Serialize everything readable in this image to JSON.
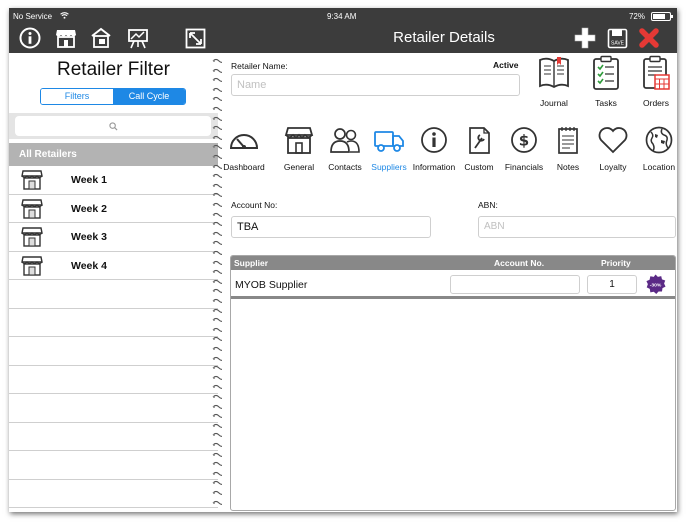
{
  "status_bar": {
    "carrier": "No Service",
    "time": "9:34 AM",
    "battery": "72%"
  },
  "header": {
    "title": "Retailer Details"
  },
  "left_panel": {
    "title": "Retailer Filter",
    "segments": [
      "Filters",
      "Call Cycle"
    ],
    "selected_segment": "Call Cycle",
    "search_placeholder": "",
    "section_header": "All Retailers",
    "items": [
      {
        "label": "Week 1"
      },
      {
        "label": "Week 2"
      },
      {
        "label": "Week 3"
      },
      {
        "label": "Week 4"
      }
    ]
  },
  "retailer": {
    "name_label": "Retailer Name:",
    "status": "Active",
    "name_placeholder": "Name",
    "name_value": ""
  },
  "actions": [
    {
      "label": "Journal",
      "icon": "journal-icon"
    },
    {
      "label": "Tasks",
      "icon": "tasks-icon"
    },
    {
      "label": "Orders",
      "icon": "orders-icon"
    }
  ],
  "tabs": [
    {
      "label": "Dashboard",
      "icon": "gauge-icon"
    },
    {
      "label": "General",
      "icon": "storefront-icon"
    },
    {
      "label": "Contacts",
      "icon": "people-icon"
    },
    {
      "label": "Suppliers",
      "icon": "truck-icon",
      "active": true
    },
    {
      "label": "Information",
      "icon": "info-icon"
    },
    {
      "label": "Custom",
      "icon": "wrench-document-icon"
    },
    {
      "label": "Financials",
      "icon": "dollar-icon"
    },
    {
      "label": "Notes",
      "icon": "notepad-icon"
    },
    {
      "label": "Loyalty",
      "icon": "heart-icon"
    },
    {
      "label": "Location",
      "icon": "globe-icon"
    }
  ],
  "fields": {
    "account_label": "Account No:",
    "account_value": "TBA",
    "abn_label": "ABN:",
    "abn_placeholder": "ABN"
  },
  "supplier_table": {
    "columns": [
      "Supplier",
      "Account No.",
      "Priority"
    ],
    "rows": [
      {
        "supplier": "MYOB Supplier",
        "account_no": "",
        "priority": "1",
        "badge": "-30%"
      }
    ]
  },
  "colors": {
    "bar": "#3c3c3c",
    "accent": "#1e88e5",
    "close": "#e53935",
    "badge": "#5b2a86"
  }
}
